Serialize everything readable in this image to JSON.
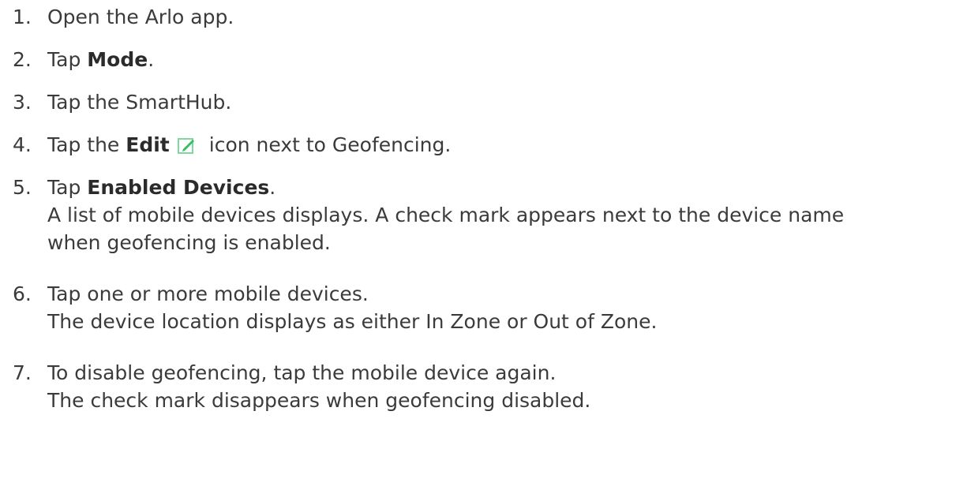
{
  "steps": [
    {
      "num": "1.",
      "parts": {
        "text": "Open the Arlo app."
      }
    },
    {
      "num": "2.",
      "parts": {
        "pre": "Tap ",
        "bold": "Mode",
        "post": "."
      }
    },
    {
      "num": "3.",
      "parts": {
        "text": "Tap the SmartHub."
      }
    },
    {
      "num": "4.",
      "parts": {
        "pre": "Tap the ",
        "bold": "Edit",
        "icon": "pencil-edit-icon",
        "post": "icon next to Geofencing."
      }
    },
    {
      "num": "5.",
      "parts": {
        "pre": "Tap ",
        "bold": "Enabled Devices",
        "post": "."
      },
      "detail": [
        "A list of mobile devices displays. A check mark appears next to the device name",
        "when geofencing is enabled."
      ]
    },
    {
      "num": "6.",
      "parts": {
        "text": "Tap one or more mobile devices."
      },
      "detail": [
        "The device location displays as either In Zone or Out of Zone."
      ]
    },
    {
      "num": "7.",
      "parts": {
        "text": "To disable geofencing, tap the mobile device again."
      },
      "detail": [
        "The check mark disappears when geofencing disabled."
      ]
    }
  ],
  "colors": {
    "text": "#3b3b3b",
    "edit_icon_fill": "#2fbf5f",
    "edit_icon_border": "#7fd99c"
  }
}
